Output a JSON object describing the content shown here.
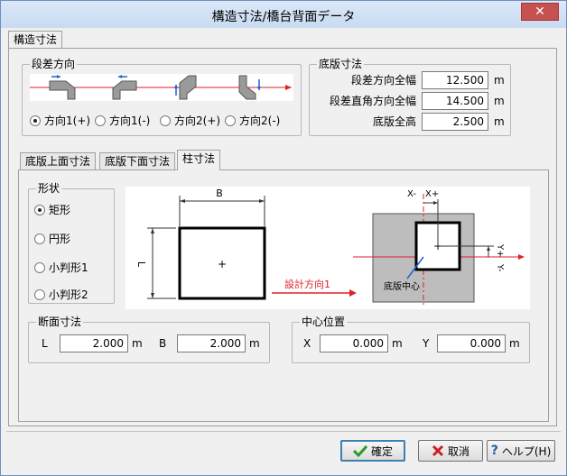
{
  "window": {
    "title": "構造寸法/橋台背面データ",
    "close_glyph": "✕"
  },
  "main_tab": {
    "label": "構造寸法"
  },
  "step_direction": {
    "title": "段差方向",
    "options": [
      "方向1(+)",
      "方向1(-)",
      "方向2(+)",
      "方向2(-)"
    ],
    "selected": 0
  },
  "slab_dims": {
    "title": "底版寸法",
    "rows": [
      {
        "label": "段差方向全幅",
        "value": "12.500",
        "unit": "m"
      },
      {
        "label": "段差直角方向全幅",
        "value": "14.500",
        "unit": "m"
      },
      {
        "label": "底版全高",
        "value": "2.500",
        "unit": "m"
      }
    ]
  },
  "sub_tabs": [
    {
      "label": "底版上面寸法"
    },
    {
      "label": "底版下面寸法"
    },
    {
      "label": "柱寸法"
    }
  ],
  "shape": {
    "title": "形状",
    "options": [
      "矩形",
      "円形",
      "小判形1",
      "小判形2"
    ],
    "selected": 0
  },
  "diagram": {
    "b_label": "B",
    "l_label": "L",
    "plus": "+",
    "design_direction": "設計方向1",
    "x_minus": "X-",
    "x_plus": "X+",
    "y_plus": "Y+",
    "y_minus": "Y-",
    "slab_center": "底版中心",
    "accent_red": "#e0202a",
    "accent_blue": "#2060d0"
  },
  "section_dims": {
    "title": "断面寸法",
    "l_label": "L",
    "l_value": "2.000",
    "l_unit": "m",
    "b_label": "B",
    "b_value": "2.000",
    "b_unit": "m"
  },
  "center_position": {
    "title": "中心位置",
    "x_label": "X",
    "x_value": "0.000",
    "x_unit": "m",
    "y_label": "Y",
    "y_value": "0.000",
    "y_unit": "m"
  },
  "buttons": {
    "ok": "確定",
    "ok_icon": "check-icon",
    "cancel": "取消",
    "cancel_icon": "cross-icon",
    "help": "ヘルプ(H)",
    "help_icon": "help-icon"
  }
}
